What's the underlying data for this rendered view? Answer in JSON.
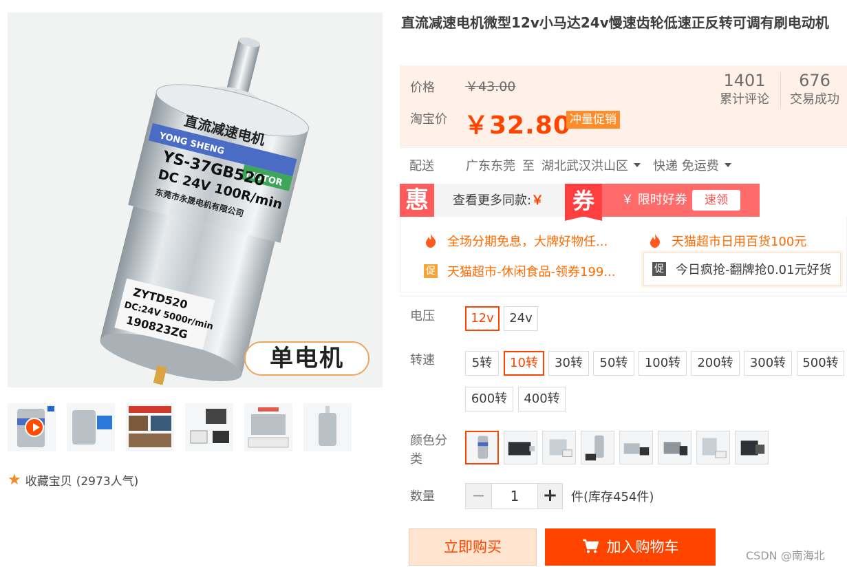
{
  "gallery": {
    "main_tag": "单电机",
    "motor_text": {
      "brand_cn": "直流减速电机",
      "brand_en": "YONG SHENG",
      "brand_motor": "MOTOR",
      "model": "YS-37GB520",
      "rating": "DC 24V 100R/min",
      "maker": "东莞市永晟电机有限公司",
      "label_line1": "ZYTD520",
      "label_line2": "DC:24V 5000r/min",
      "label_line3": "190823ZG"
    },
    "favorite": {
      "label": "收藏宝贝",
      "count": "(2973人气)"
    }
  },
  "product": {
    "title": "直流减速电机微型12v小马达24v慢速齿轮低速正反转可调有刷电动机"
  },
  "price": {
    "price_label": "价格",
    "original": "￥43.00",
    "promo_label": "淘宝价",
    "promo": "￥32.80",
    "promo_badge": "冲量促销",
    "reviews_num": "1401",
    "reviews_label": "累计评论",
    "sales_num": "676",
    "sales_label": "交易成功"
  },
  "delivery": {
    "label": "配送",
    "from": "广东东莞",
    "to_word": "至",
    "destination": "湖北武汉洪山区",
    "shipping": "快递 免运费"
  },
  "promotions": {
    "hui_icon": "惠",
    "more_same": "查看更多同款:",
    "yen": "￥",
    "quan_icon": "券",
    "quan_text": "￥ 限时好券",
    "quan_button": "速领",
    "coupons": [
      {
        "text": "全场分期免息，大牌好物任...",
        "icon": "flame-icon"
      },
      {
        "text": "天猫超市日用百货100元",
        "icon": "flame-icon"
      },
      {
        "text": "天猫超市-休闲食品-领券199...",
        "icon": "promo-icon",
        "icon_text": "促"
      },
      {
        "text": "今日疯抢-翻牌抢0.01元好货",
        "icon": "promo-icon",
        "icon_text": "促"
      }
    ]
  },
  "options": {
    "voltage": {
      "label": "电压",
      "values": [
        "12v",
        "24v"
      ],
      "selected": "12v"
    },
    "speed": {
      "label": "转速",
      "values": [
        "5转",
        "10转",
        "30转",
        "50转",
        "100转",
        "200转",
        "300转",
        "500转",
        "600转",
        "400转"
      ],
      "selected": "10转"
    },
    "color": {
      "label_line1": "颜色分",
      "label_line2": "类",
      "swatch_count": 8,
      "selected_index": 0
    },
    "quantity": {
      "label": "数量",
      "minus": "−",
      "value": "1",
      "plus": "+",
      "stock": "件(库存454件)"
    }
  },
  "actions": {
    "buy_now": "立即购买",
    "add_cart": "加入购物车"
  },
  "watermark": "CSDN @南海北",
  "colors": {
    "accent": "#ff4400",
    "price_bg": "#fff0e8",
    "promo_badge": "#ff8c2a",
    "coupon": "#ff6b6b"
  }
}
